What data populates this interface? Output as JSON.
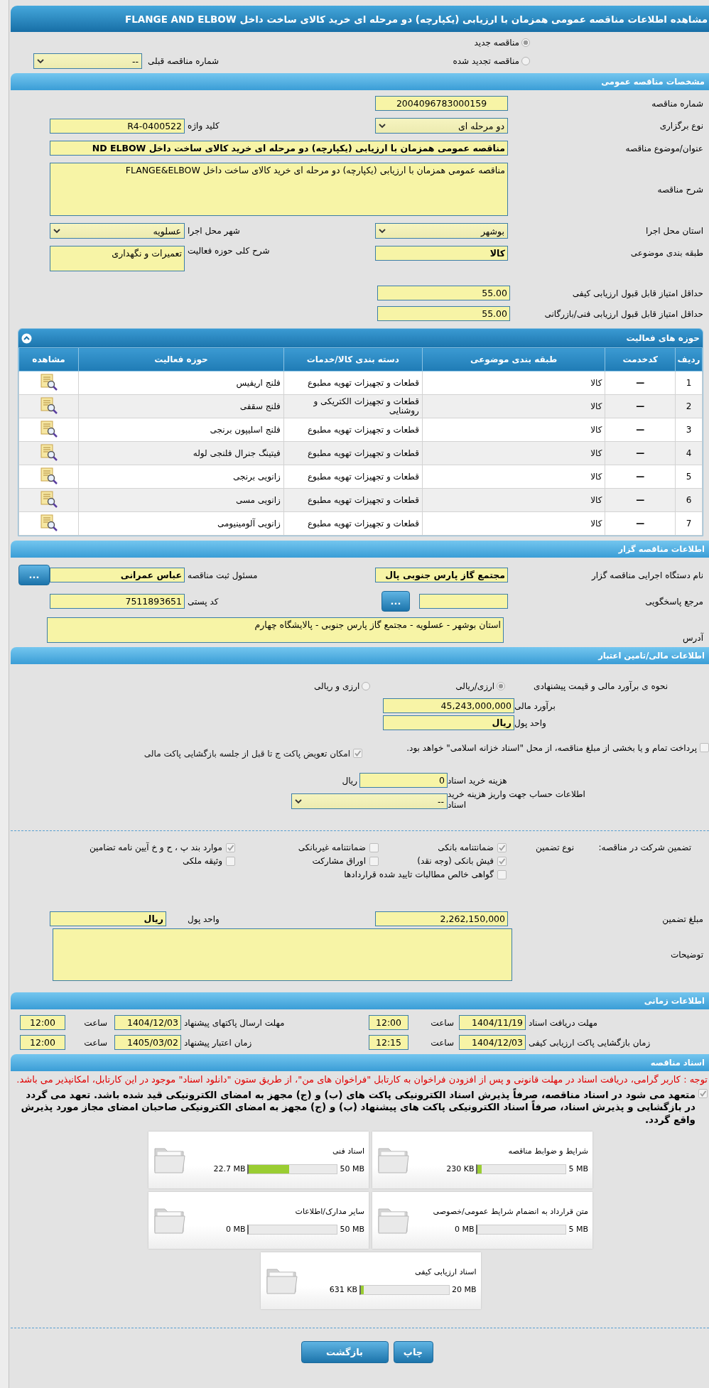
{
  "title": "مشاهده اطلاعات مناقصه عمومی همزمان با ارزیابی (یکپارچه) دو مرحله ای خرید کالای ساخت داخل FLANGE AND ELBOW",
  "tender_type": [
    {
      "label": "مناقصه جدید",
      "selected": true
    },
    {
      "label": "مناقصه تجدید شده",
      "selected": false
    }
  ],
  "previous_tender": {
    "label": "شماره مناقصه قبلی",
    "value": "--"
  },
  "general": {
    "title": "مشخصات مناقصه عمومی",
    "tender_number": {
      "label": "شماره مناقصه",
      "value": "2004096783000159"
    },
    "holding_type": {
      "label": "نوع برگزاری",
      "value": "دو مرحله ای"
    },
    "keyword": {
      "label": "کلید واژه",
      "value": "R4-0400522"
    },
    "subject": {
      "label": "عنوان/موضوع مناقصه",
      "value": "مناقصه عمومی همزمان با ارزیابی (یکپارچه) دو مرحله ای خرید کالای ساخت داخل ND ELBOW"
    },
    "description": {
      "label": "شرح مناقصه",
      "value": "مناقصه عمومی همزمان با ارزیابی (یکپارچه) دو مرحله ای خرید کالای ساخت داخل FLANGE&ELBOW"
    },
    "province": {
      "label": "استان محل اجرا",
      "value": "بوشهر"
    },
    "city": {
      "label": "شهر محل اجرا",
      "value": "عسلویه"
    },
    "category": {
      "label": "طبقه بندی موضوعی",
      "value": "کالا"
    },
    "activity_summary": {
      "label": "شرح کلی حوزه فعالیت",
      "value": "تعمیرات و نگهداری"
    },
    "min_quality_score": {
      "label": "حداقل امتیاز قابل قبول ارزیابی کیفی",
      "value": "55.00"
    },
    "min_technical_score": {
      "label": "حداقل امتیاز قابل قبول ارزیابی فنی/بازرگانی",
      "value": "55.00"
    }
  },
  "activities": {
    "title": "حوزه های فعالیت",
    "columns": [
      "ردیف",
      "کدخدمت",
      "طبقه بندی موضوعی",
      "دسته بندی کالا/خدمات",
      "حوزه فعالیت",
      "مشاهده"
    ],
    "rows": [
      {
        "row": "1",
        "service_code": "—",
        "category": "کالا",
        "group": "قطعات و تجهیزات تهویه مطبوع",
        "activity": "فلنج اریفیس"
      },
      {
        "row": "2",
        "service_code": "—",
        "category": "کالا",
        "group": "قطعات و تجهیزات الکتریکی و روشنایی",
        "activity": "فلنج سقفی"
      },
      {
        "row": "3",
        "service_code": "—",
        "category": "کالا",
        "group": "قطعات و تجهیزات تهویه مطبوع",
        "activity": "فلنج اسلیپون برنجی"
      },
      {
        "row": "4",
        "service_code": "—",
        "category": "کالا",
        "group": "قطعات و تجهیزات تهویه مطبوع",
        "activity": "فیتینگ جنرال فلنجی لوله"
      },
      {
        "row": "5",
        "service_code": "—",
        "category": "کالا",
        "group": "قطعات و تجهیزات تهویه مطبوع",
        "activity": "زانویی برنجی"
      },
      {
        "row": "6",
        "service_code": "—",
        "category": "کالا",
        "group": "قطعات و تجهیزات تهویه مطبوع",
        "activity": "زانویی مسی"
      },
      {
        "row": "7",
        "service_code": "—",
        "category": "کالا",
        "group": "قطعات و تجهیزات تهویه مطبوع",
        "activity": "زانویی آلومینیومی"
      }
    ]
  },
  "organizer": {
    "title": "اطلاعات مناقصه گزار",
    "organization": {
      "label": "نام دستگاه اجرایی مناقصه گزار",
      "value": "مجتمع گاز پارس جنوبی  پال"
    },
    "registrar": {
      "label": "مسئول ثبت مناقصه",
      "value": "عباس عمرانی"
    },
    "response_ref": {
      "label": "مرجع پاسخگویی"
    },
    "postal_code": {
      "label": "کد پستی",
      "value": "7511893651"
    },
    "address": {
      "label": "آدرس",
      "value": "استان بوشهر - عسلویه - مجتمع گاز پارس جنوبی - پالایشگاه چهارم"
    },
    "browse_buttons": [
      "...",
      "..."
    ]
  },
  "finance": {
    "title": "اطلاعات مالی/تامین اعتبار",
    "method": {
      "label": "نحوه ی برآورد مالی و قیمت پیشنهادی",
      "options": [
        {
          "label": "ارزی/ریالی",
          "selected": true
        },
        {
          "label": "ارزی و ریالی",
          "selected": false
        }
      ]
    },
    "estimate": {
      "label": "برآورد مالی",
      "value": "45,243,000,000"
    },
    "currency": {
      "label": "واحد پول",
      "value": "ریال"
    },
    "treasury_payment": {
      "label": "پرداخت تمام و یا بخشی از مبلغ مناقصه، از محل \"اسناد خزانه اسلامی\" خواهد بود.",
      "checked": false
    },
    "envelope_swap": {
      "label": "امکان تعویض پاکت ج تا قبل از جلسه بازگشایی پاکت مالی",
      "checked": true
    },
    "doc_fee": {
      "label": "هزینه خرید اسناد",
      "value": "0",
      "unit": "ریال"
    },
    "account": {
      "label": "اطلاعات حساب جهت واریز هزینه خرید اسناد",
      "value": "--"
    }
  },
  "guarantee": {
    "label": "تضمین شرکت در مناقصه:",
    "type_label": "نوع تضمین",
    "options": [
      {
        "label": "ضمانتنامه بانکی",
        "checked": true
      },
      {
        "label": "ضمانتنامه غیربانکی",
        "checked": false
      },
      {
        "label": "موارد بند پ ، ح و خ آیین نامه تضامین",
        "checked": true
      },
      {
        "label": "فیش بانکی (وجه نقد)",
        "checked": true
      },
      {
        "label": "اوراق مشارکت",
        "checked": false
      },
      {
        "label": "وثیقه ملکی",
        "checked": false
      },
      {
        "label": "گواهی خالص مطالبات تایید شده قراردادها",
        "checked": false
      }
    ],
    "amount": {
      "label": "مبلغ تضمین",
      "value": "2,262,150,000"
    },
    "currency": {
      "label": "واحد پول",
      "value": "ریال"
    },
    "notes": {
      "label": "توضیحات"
    }
  },
  "schedule": {
    "title": "اطلاعات زمانی",
    "items": [
      {
        "label": "مهلت دریافت اسناد",
        "date": "1404/11/19",
        "time_label": "ساعت",
        "time": "12:00"
      },
      {
        "label": "مهلت ارسال پاکتهای پیشنهاد",
        "date": "1404/12/03",
        "time_label": "ساعت",
        "time": "12:00"
      },
      {
        "label": "زمان بازگشایی پاکت ارزیابی کیفی",
        "date": "1404/12/03",
        "time_label": "ساعت",
        "time": "12:15"
      },
      {
        "label": "زمان اعتبار پیشنهاد",
        "date": "1405/03/02",
        "time_label": "ساعت",
        "time": "12:00"
      }
    ]
  },
  "documents": {
    "title": "اسناد مناقصه",
    "notice": "توجه : کاربر گرامی، دریافت اسناد در مهلت قانونی و پس از افزودن فراخوان به کارتابل \"فراخوان های من\"، از طریق ستون \"دانلود اسناد\" موجود در این کارتابل، امکانپذیر می باشد.",
    "commitment": {
      "text": "متعهد می شود در اسناد مناقصه، صرفاً پذیرش اسناد الکترونیکی پاکت های (ب) و (ج) مجهز به امضای الکترونیکی قید شده باشد. تعهد می گردد در بازگشایی و پذیرش اسناد، صرفاً اسناد الکترونیکی پاکت های پیشنهاد (ب) و (ج) مجهز به امضای الکترونیکی صاحبان امضای مجاز مورد پذیرش واقع گردد.",
      "checked": true
    },
    "files": [
      {
        "name": "شرایط و ضوابط مناقصه",
        "limit": "5 MB",
        "size": "230 KB",
        "level": 0.045
      },
      {
        "name": "اسناد فنی",
        "limit": "50 MB",
        "size": "22.7 MB",
        "level": 0.454
      },
      {
        "name": "متن قرارداد به انضمام شرایط عمومی/خصوصی",
        "limit": "5 MB",
        "size": "0 MB",
        "level": 0
      },
      {
        "name": "سایر مدارک/اطلاعات",
        "limit": "50 MB",
        "size": "0 MB",
        "level": 0
      },
      {
        "name": "اسناد ارزیابی کیفی",
        "limit": "20 MB",
        "size": "631 KB",
        "level": 0.031
      }
    ]
  },
  "buttons": [
    "چاپ",
    "بازگشت"
  ]
}
